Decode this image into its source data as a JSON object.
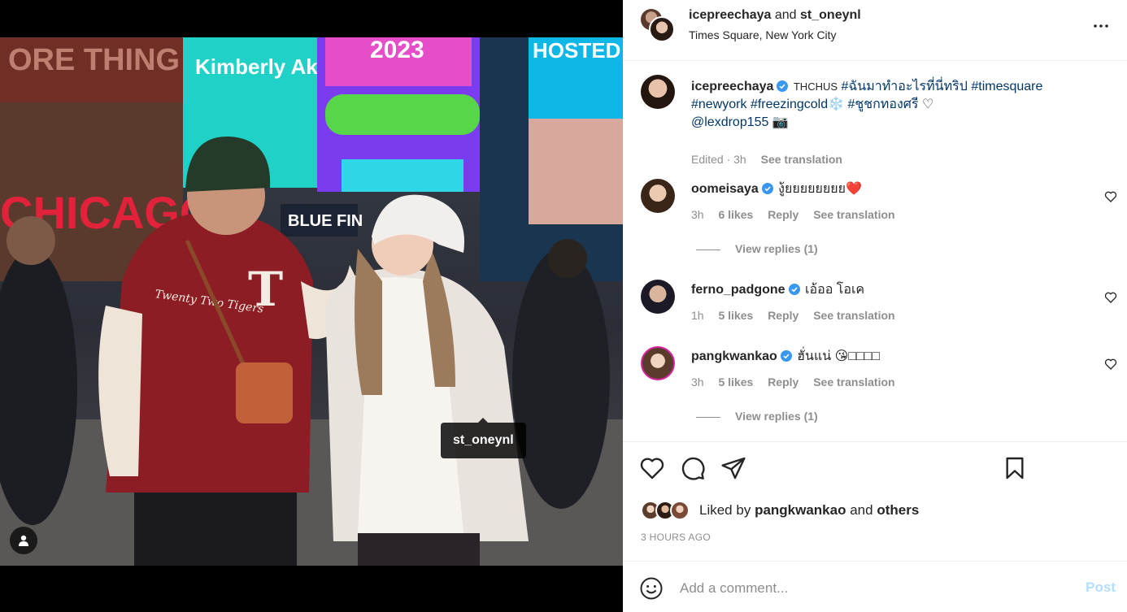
{
  "media": {
    "tag_label": "st_oneynl",
    "user_tag_icon": "user-icon",
    "sign_texts": {
      "chicago": "CHICAGO",
      "kimberly": "Kimberly Akimbo",
      "year": "2023",
      "hosted": "HOSTED",
      "bluefin": "BLUE FIN",
      "jacket_text": "Twenty Two Tigers"
    }
  },
  "header": {
    "user1": "icepreechaya",
    "connector": "and",
    "user2": "st_oneynl",
    "location": "Times Square, New York City",
    "more_icon": "more-horizontal-icon"
  },
  "caption": {
    "username": "icepreechaya",
    "prefix": "THCHUS",
    "tag1": "#ฉันมาทำอะไรที่นี่ทริป",
    "tag2": "#timesquare",
    "tag3": "#newyork",
    "tag4": "#freezingcold",
    "emoji1": "❄️",
    "tag5": "#ชูชกทองศรี",
    "emoji2": "♡",
    "mention": "@lexdrop155",
    "emoji3": "📷",
    "edited": "Edited · 3h",
    "see_translation": "See translation"
  },
  "comments": [
    {
      "username": "oomeisaya",
      "text": "งู้ยยยยยยยย❤️",
      "time": "3h",
      "likes": "6 likes",
      "reply": "Reply",
      "see_translation": "See translation",
      "view_replies": "View replies (1)"
    },
    {
      "username": "ferno_padgone",
      "text": "เอ้ออ โอเค",
      "time": "1h",
      "likes": "5 likes",
      "reply": "Reply",
      "see_translation": "See translation"
    },
    {
      "username": "pangkwankao",
      "text": "ฮั่นแน่ 😘□□□□",
      "time": "3h",
      "likes": "5 likes",
      "reply": "Reply",
      "see_translation": "See translation",
      "view_replies": "View replies (1)"
    }
  ],
  "actions": {
    "like_icon": "heart-icon",
    "comment_icon": "comment-icon",
    "share_icon": "send-icon",
    "save_icon": "bookmark-icon"
  },
  "likes": {
    "prefix": "Liked by",
    "user": "pangkwankao",
    "connector": "and",
    "others": "others"
  },
  "timestamp": "3 HOURS AGO",
  "comment_box": {
    "emoji_icon": "smiley-icon",
    "placeholder": "Add a comment...",
    "post_label": "Post"
  },
  "colors": {
    "link": "#00376b",
    "verified": "#3897f0",
    "muted": "#8e8e8e",
    "post_disabled": "#b2dffc"
  }
}
